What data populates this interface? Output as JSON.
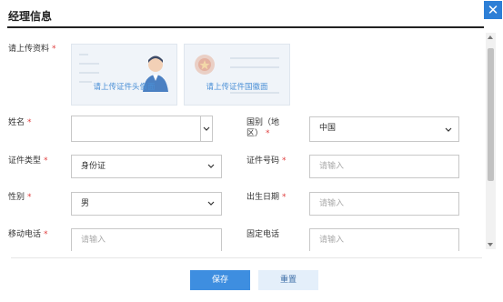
{
  "dialog": {
    "title": "经理信息",
    "close_icon": "close-icon"
  },
  "form": {
    "upload": {
      "label": "请上传资料",
      "required_mark": "*",
      "portrait_text": "请上传证件头像面",
      "emblem_text": "请上传证件国徽面"
    },
    "name": {
      "label": "姓名",
      "required_mark": "*",
      "value": ""
    },
    "country": {
      "label_line1": "国别（地",
      "label_line2": "区）",
      "required_mark": "*",
      "value": "中国"
    },
    "id_type": {
      "label": "证件类型",
      "required_mark": "*",
      "value": "身份证"
    },
    "id_number": {
      "label": "证件号码",
      "required_mark": "*",
      "placeholder": "请输入"
    },
    "gender": {
      "label": "性别",
      "required_mark": "*",
      "value": "男"
    },
    "birth_date": {
      "label": "出生日期",
      "required_mark": "*",
      "placeholder": "请输入"
    },
    "mobile": {
      "label": "移动电话",
      "required_mark": "*",
      "placeholder": "请输入"
    },
    "landline": {
      "label": "固定电话",
      "placeholder": "请输入"
    }
  },
  "buttons": {
    "save_label": "保存",
    "reset_label": "重置"
  },
  "colors": {
    "accent": "#3e8ee0",
    "close_bg": "#2d7fd6",
    "required": "#e04040",
    "upload_text": "#4a8fd6"
  }
}
